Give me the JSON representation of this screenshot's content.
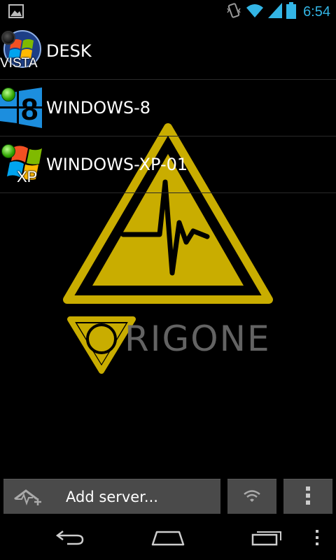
{
  "status_bar": {
    "time": "6:54",
    "icons": [
      "image-notification-icon",
      "vibrate-icon",
      "wifi-icon",
      "signal-icon",
      "battery-icon"
    ]
  },
  "servers": [
    {
      "name": "DESK",
      "os": "VISTA",
      "status": "offline"
    },
    {
      "name": "WINDOWS-8",
      "os": "8",
      "status": "online"
    },
    {
      "name": "WINDOWS-XP-01",
      "os": "XP",
      "status": "online"
    }
  ],
  "watermark": {
    "brand": "RIGONE",
    "emblem_letter": "T"
  },
  "action_bar": {
    "add_label": "Add server..."
  },
  "colors": {
    "accent": "#33b5e5",
    "logo_yellow": "#c9ad00",
    "button_gray": "#4a4a4a",
    "online_green": "#2fa300"
  }
}
